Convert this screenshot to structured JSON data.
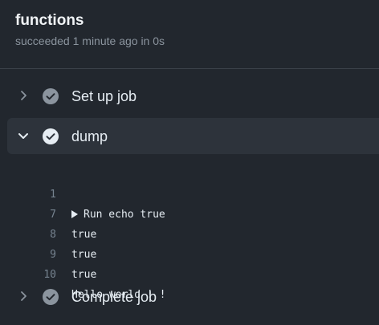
{
  "job": {
    "title": "functions",
    "status": "succeeded 1 minute ago in 0s"
  },
  "steps": [
    {
      "label": "Set up job",
      "expanded": false,
      "status": "success"
    },
    {
      "label": "dump",
      "expanded": true,
      "status": "success"
    },
    {
      "label": "Complete job",
      "expanded": false,
      "status": "success"
    }
  ],
  "log": {
    "lines": [
      {
        "number": "1",
        "text": "Run echo true",
        "collapsible": true
      },
      {
        "number": "7",
        "text": "true"
      },
      {
        "number": "8",
        "text": "true"
      },
      {
        "number": "9",
        "text": "true"
      },
      {
        "number": "10",
        "text": "Hello world ! !"
      }
    ]
  },
  "colors": {
    "background": "#22272e",
    "expanded_step_bg": "#2d333b",
    "muted_text": "#8b949e",
    "line_number": "#768390",
    "check_done": "#adbac7"
  }
}
